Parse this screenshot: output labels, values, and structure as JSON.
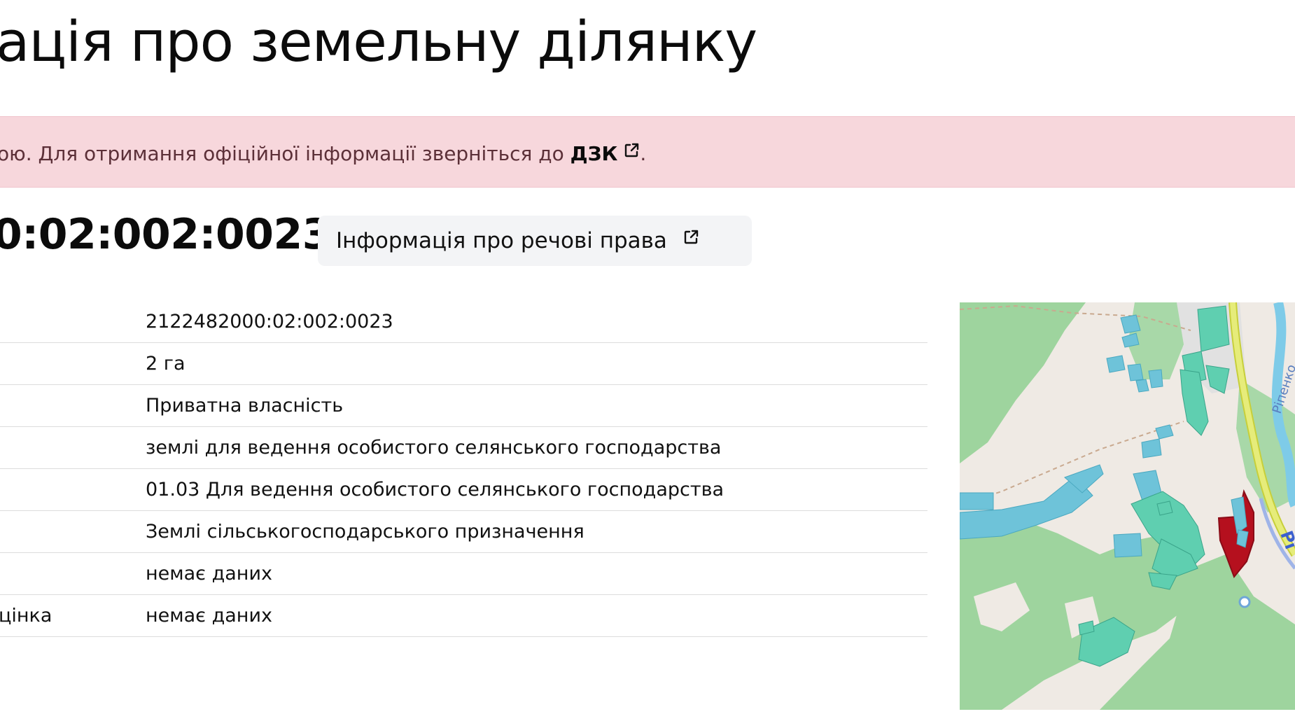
{
  "page": {
    "title": "ація про земельну ділянку"
  },
  "alert": {
    "text": "ою. Для отримання офіційної інформації зверніться до ",
    "link_label": "ДЗК",
    "suffix": "."
  },
  "parcel": {
    "cadastral_number": "0:02:002:0023",
    "rights_button_label": "Інформація про речові права"
  },
  "details": [
    {
      "label": "",
      "value": "2122482000:02:002:0023"
    },
    {
      "label": "",
      "value": "2 га"
    },
    {
      "label": "",
      "value": "Приватна власність"
    },
    {
      "label": "",
      "value": "землі для ведення особистого селянського господарства"
    },
    {
      "label": "",
      "value": "01.03 Для ведення особистого селянського господарства"
    },
    {
      "label": "",
      "value": "Землі сільськогосподарського призначення"
    },
    {
      "label": "",
      "value": "немає даних"
    },
    {
      "label": "цінка",
      "value": "немає даних"
    }
  ],
  "map": {
    "street_label": "Ріпенко",
    "street_label_2": "Рі",
    "colors": {
      "background": "#efeae4",
      "forest": "#8fd18f",
      "parcel_teal": "#5fcfb0",
      "parcel_blue": "#6ec3d9",
      "highlight": "#b5101e",
      "road": "#d9e85a",
      "river": "#7ecbe8"
    }
  }
}
